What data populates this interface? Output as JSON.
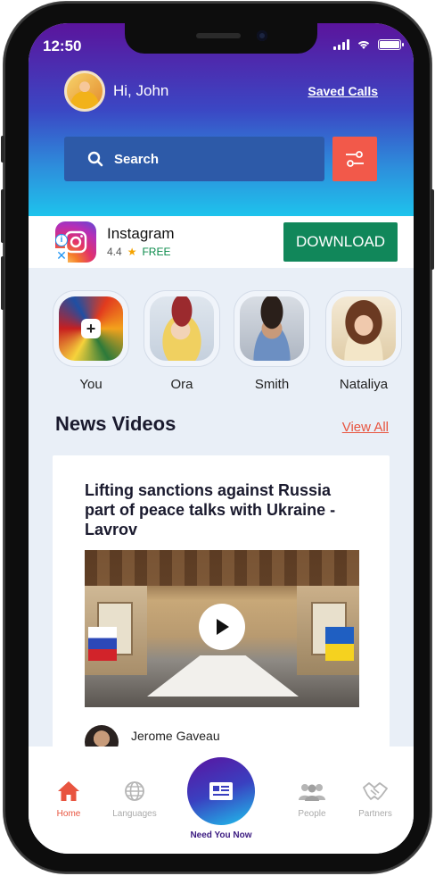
{
  "status_bar": {
    "time": "12:50"
  },
  "header": {
    "greeting": "Hi, John",
    "saved_calls_label": "Saved Calls"
  },
  "search": {
    "placeholder": "Search"
  },
  "ad": {
    "app_name": "Instagram",
    "rating": "4.4",
    "price": "FREE",
    "cta_label": "DOWNLOAD"
  },
  "stories": [
    {
      "name": "You"
    },
    {
      "name": "Ora"
    },
    {
      "name": "Smith"
    },
    {
      "name": "Nataliya"
    }
  ],
  "news_section": {
    "title": "News Videos",
    "view_all_label": "View All",
    "card": {
      "headline": "Lifting sanctions against Russia part of peace talks with Ukraine - Lavrov",
      "author": "Jerome Gaveau"
    }
  },
  "bottom_nav": {
    "items": [
      {
        "label": "Home",
        "icon": "home-icon",
        "active": true
      },
      {
        "label": "Languages",
        "icon": "globe-icon",
        "active": false
      },
      {
        "label": "Need You Now",
        "icon": "news-icon",
        "active": false
      },
      {
        "label": "People",
        "icon": "people-icon",
        "active": false
      },
      {
        "label": "Partners",
        "icon": "handshake-icon",
        "active": false
      }
    ]
  },
  "colors": {
    "accent_red": "#e8543f",
    "download_green": "#11875a",
    "search_blue": "#2d5aa8",
    "header_top": "#5b149c",
    "header_bottom": "#1ec3ec"
  }
}
